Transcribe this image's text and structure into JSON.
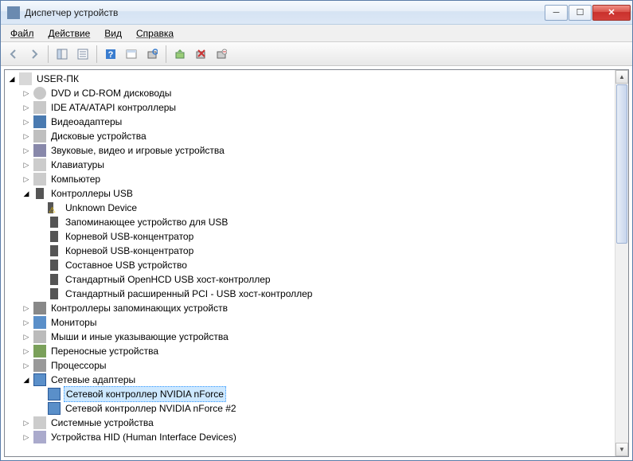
{
  "window": {
    "title": "Диспетчер устройств"
  },
  "menu": {
    "file": "Файл",
    "action": "Действие",
    "view": "Вид",
    "help": "Справка"
  },
  "tree": {
    "root": "USER-ПК",
    "dvd": "DVD и CD-ROM дисководы",
    "ide": "IDE ATA/ATAPI контроллеры",
    "video": "Видеоадаптеры",
    "disk": "Дисковые устройства",
    "sound": "Звуковые, видео и игровые устройства",
    "keyboard": "Клавиатуры",
    "computer": "Компьютер",
    "usb": "Контроллеры USB",
    "usb_children": {
      "unknown": "Unknown Device",
      "storage": "Запоминающее устройство для USB",
      "hub1": "Корневой USB-концентратор",
      "hub2": "Корневой USB-концентратор",
      "composite": "Составное USB устройство",
      "openhcd": "Стандартный OpenHCD USB хост-контроллер",
      "pci": "Стандартный расширенный PCI - USB хост-контроллер"
    },
    "storagectl": "Контроллеры запоминающих устройств",
    "monitor": "Мониторы",
    "mouse": "Мыши и иные указывающие устройства",
    "portable": "Переносные устройства",
    "cpu": "Процессоры",
    "netadapters": "Сетевые адаптеры",
    "net_children": {
      "nforce1": "Сетевой контроллер NVIDIA nForce",
      "nforce2": "Сетевой контроллер NVIDIA nForce #2"
    },
    "system": "Системные устройства",
    "hid": "Устройства HID (Human Interface Devices)"
  }
}
